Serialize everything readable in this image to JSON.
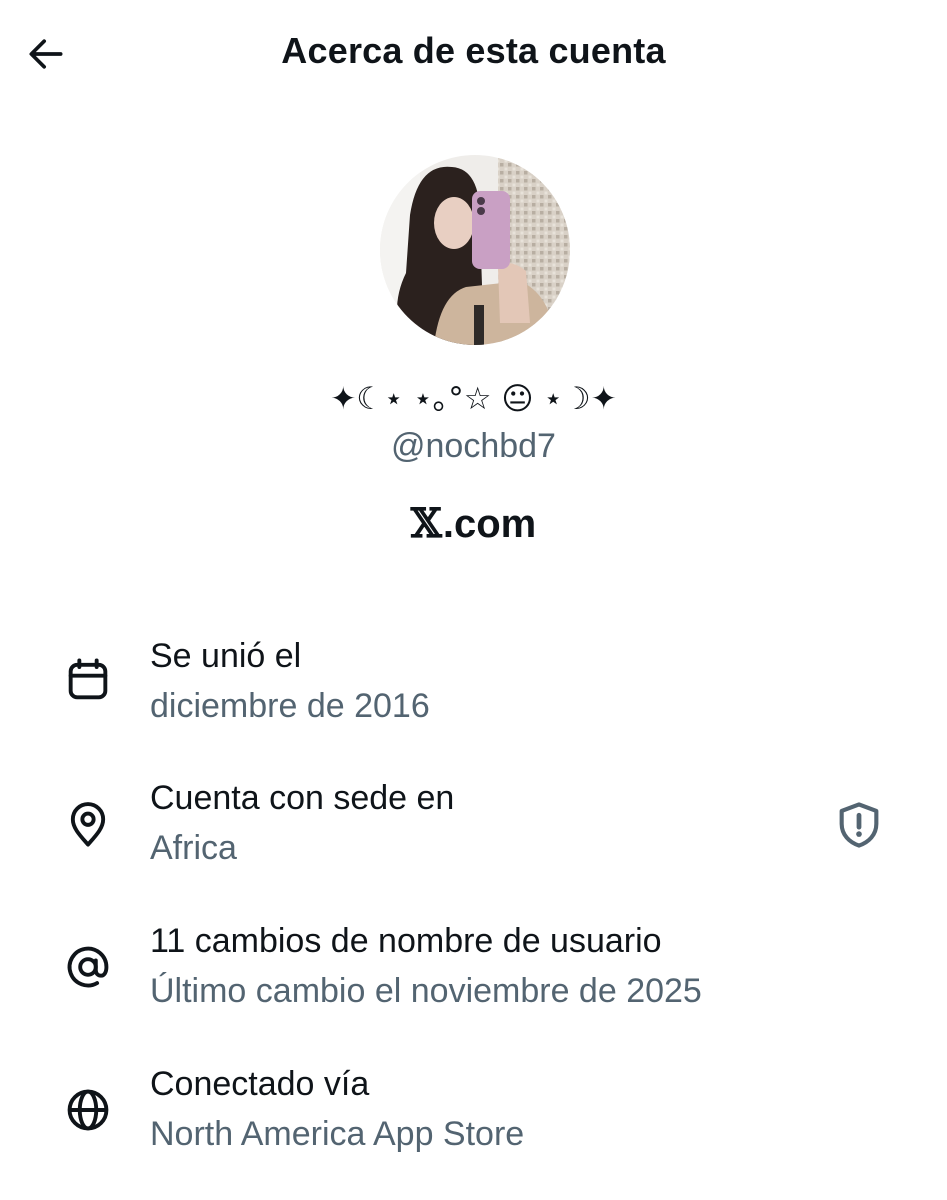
{
  "header": {
    "title": "Acerca de esta cuenta",
    "back_icon": "arrow-left-icon"
  },
  "profile": {
    "display_name": "✦☾⋆ ⋆｡°☆ 😐 ⋆☽✦",
    "handle": "@nochbd7",
    "site_logo": "𝕏",
    "site_suffix": ".com"
  },
  "details": [
    {
      "icon": "calendar-icon",
      "title": "Se unió el",
      "value": "diciembre de 2016"
    },
    {
      "icon": "location-pin-icon",
      "title": "Cuenta con sede en",
      "value": "Africa",
      "trailing_icon": "shield-alert-icon"
    },
    {
      "icon": "at-sign-icon",
      "title": "11 cambios de nombre de usuario",
      "value": "Último cambio el noviembre de 2025"
    },
    {
      "icon": "globe-icon",
      "title": "Conectado vía",
      "value": "North America App Store"
    }
  ],
  "colors": {
    "primary_text": "#0f1419",
    "secondary_text": "#536471",
    "background": "#ffffff"
  }
}
